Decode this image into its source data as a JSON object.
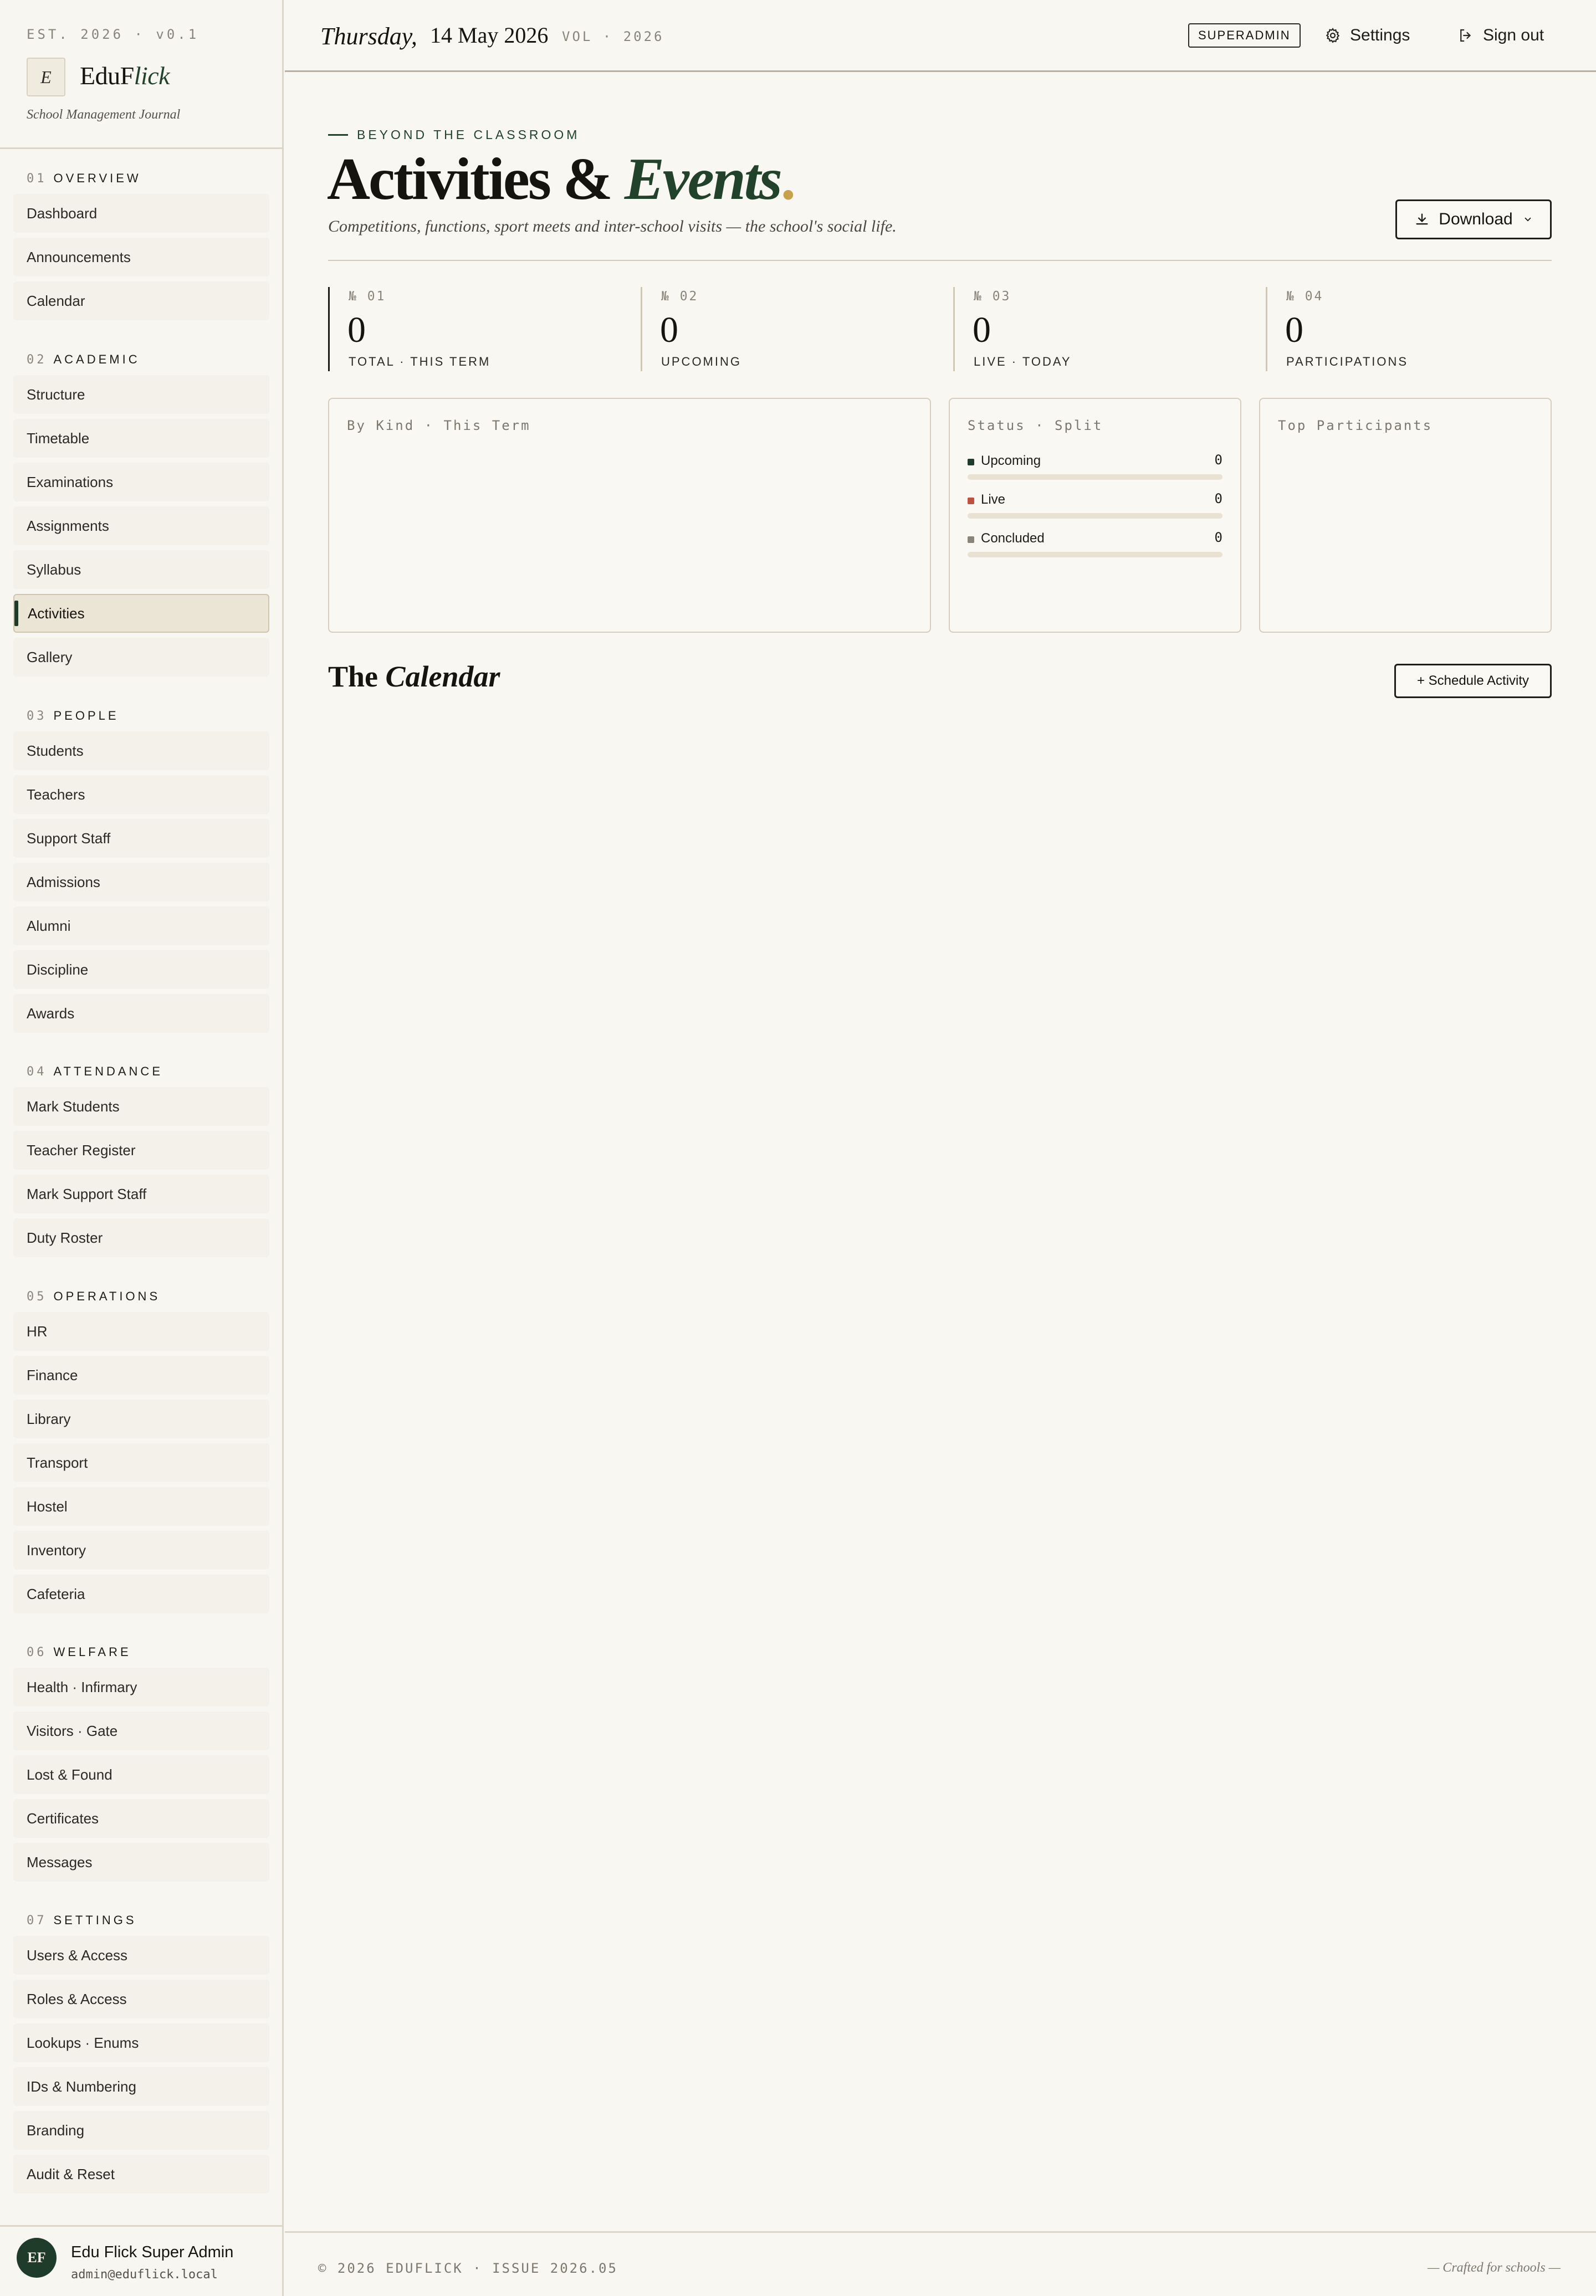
{
  "brand": {
    "est": "EST. 2026 · v0.1",
    "logo_letter": "E",
    "name_main": "EduF",
    "name_italic": "lick",
    "tagline": "School Management Journal"
  },
  "sidebar": {
    "sections": [
      {
        "num": "01",
        "title": "OVERVIEW",
        "items": [
          "Dashboard",
          "Announcements",
          "Calendar"
        ]
      },
      {
        "num": "02",
        "title": "ACADEMIC",
        "items": [
          "Structure",
          "Timetable",
          "Examinations",
          "Assignments",
          "Syllabus",
          "Activities",
          "Gallery"
        ]
      },
      {
        "num": "03",
        "title": "PEOPLE",
        "items": [
          "Students",
          "Teachers",
          "Support Staff",
          "Admissions",
          "Alumni",
          "Discipline",
          "Awards"
        ]
      },
      {
        "num": "04",
        "title": "ATTENDANCE",
        "items": [
          "Mark Students",
          "Teacher Register",
          "Mark Support Staff",
          "Duty Roster"
        ]
      },
      {
        "num": "05",
        "title": "OPERATIONS",
        "items": [
          "HR",
          "Finance",
          "Library",
          "Transport",
          "Hostel",
          "Inventory",
          "Cafeteria"
        ]
      },
      {
        "num": "06",
        "title": "WELFARE",
        "items": [
          "Health · Infirmary",
          "Visitors · Gate",
          "Lost & Found",
          "Certificates",
          "Messages"
        ]
      },
      {
        "num": "07",
        "title": "SETTINGS",
        "items": [
          "Users & Access",
          "Roles & Access",
          "Lookups · Enums",
          "IDs & Numbering",
          "Branding",
          "Audit & Reset"
        ]
      }
    ],
    "active_item": "Activities"
  },
  "user": {
    "initials": "EF",
    "name": "Edu Flick Super Admin",
    "email": "admin@eduflick.local"
  },
  "header": {
    "day": "Thursday,",
    "date": "14 May 2026",
    "vol": "VOL · 2026",
    "role_badge": "SUPERADMIN",
    "settings_label": "Settings",
    "signout_label": "Sign out"
  },
  "page": {
    "eyebrow": "BEYOND THE CLASSROOM",
    "title_main": "Activities & ",
    "title_italic": "Events",
    "title_dot": ".",
    "subtitle": "Competitions, functions, sport meets and inter-school visits — the school's social life.",
    "download_label": "Download"
  },
  "stats": [
    {
      "idx": "№ 01",
      "value": "0",
      "label": "TOTAL · THIS TERM"
    },
    {
      "idx": "№ 02",
      "value": "0",
      "label": "UPCOMING"
    },
    {
      "idx": "№ 03",
      "value": "0",
      "label": "LIVE · TODAY"
    },
    {
      "idx": "№ 04",
      "value": "0",
      "label": "PARTICIPATIONS"
    }
  ],
  "cards": {
    "by_kind_title": "By Kind · This Term",
    "status_title": "Status · Split",
    "status_rows": [
      {
        "label": "Upcoming",
        "count": "0",
        "color": "#1f3b2a",
        "fraction": 0
      },
      {
        "label": "Live",
        "count": "0",
        "color": "#c0513f",
        "fraction": 0
      },
      {
        "label": "Concluded",
        "count": "0",
        "color": "#8a857b",
        "fraction": 0
      }
    ],
    "top_title": "Top Participants"
  },
  "calendar": {
    "title_main": "The ",
    "title_italic": "Calendar",
    "schedule_label": "+ Schedule Activity"
  },
  "footer": {
    "left": "© 2026 EDUFLICK · ISSUE 2026.05",
    "right": "— Crafted for schools —"
  }
}
